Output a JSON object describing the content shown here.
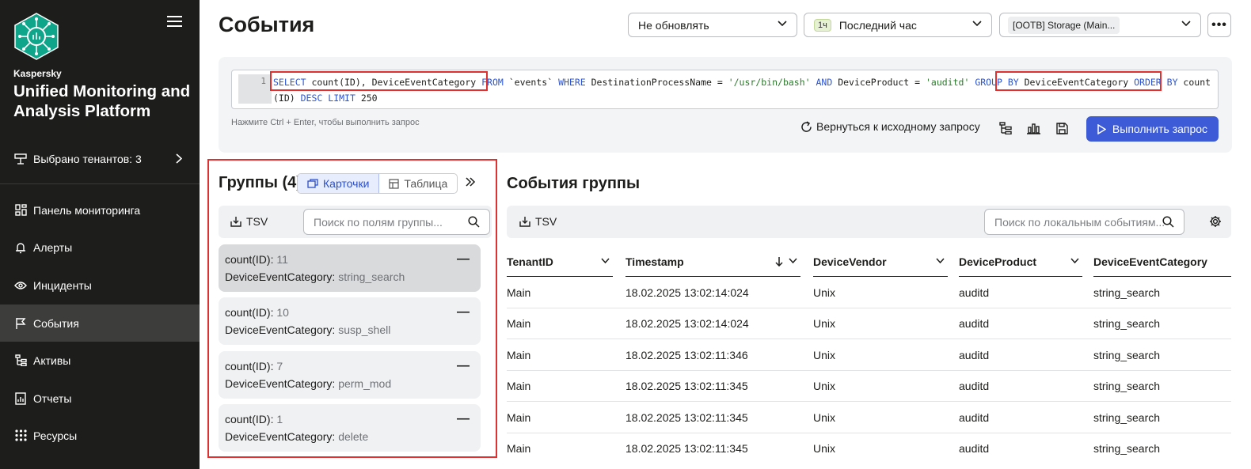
{
  "sidebar": {
    "brand_small": "Kaspersky",
    "brand_big": "Unified Monitoring and Analysis Platform",
    "tenants_label": "Выбрано тенантов: 3",
    "items": [
      {
        "label": "Панель мониторинга",
        "icon": "dashboard-icon"
      },
      {
        "label": "Алерты",
        "icon": "bell-icon"
      },
      {
        "label": "Инциденты",
        "icon": "eye-icon"
      },
      {
        "label": "События",
        "icon": "flag-icon",
        "active": true
      },
      {
        "label": "Активы",
        "icon": "tree-icon"
      },
      {
        "label": "Отчеты",
        "icon": "report-icon"
      },
      {
        "label": "Ресурсы",
        "icon": "grid-icon"
      }
    ]
  },
  "header": {
    "title": "События",
    "refresh_select": "Не обновлять",
    "period_badge": "1ч",
    "period_select": "Последний час",
    "storage_select": "[OOTB] Storage (Main..."
  },
  "query": {
    "line_number": "1",
    "hint": "Нажмите Ctrl + Enter, чтобы выполнить запрос",
    "back_label": "Вернуться к исходному запросу",
    "run_label": "Выполнить запрос"
  },
  "groups": {
    "title": "Группы (4)",
    "view_cards": "Карточки",
    "view_table": "Таблица",
    "tsv_label": "TSV",
    "search_placeholder": "Поиск по полям группы...",
    "cards": [
      {
        "count_key": "count(ID):",
        "count_val": "11",
        "cat_key": "DeviceEventCategory:",
        "cat_val": "string_search"
      },
      {
        "count_key": "count(ID):",
        "count_val": "10",
        "cat_key": "DeviceEventCategory:",
        "cat_val": "susp_shell"
      },
      {
        "count_key": "count(ID):",
        "count_val": "7",
        "cat_key": "DeviceEventCategory:",
        "cat_val": "perm_mod"
      },
      {
        "count_key": "count(ID):",
        "count_val": "1",
        "cat_key": "DeviceEventCategory:",
        "cat_val": "delete"
      }
    ]
  },
  "events_group": {
    "title": "События группы",
    "tsv_label": "TSV",
    "search_placeholder": "Поиск по локальным событиям...",
    "columns": [
      "TenantID",
      "Timestamp",
      "DeviceVendor",
      "DeviceProduct",
      "DeviceEventCategory"
    ],
    "rows": [
      [
        "Main",
        "18.02.2025 13:02:14:024",
        "Unix",
        "auditd",
        "string_search"
      ],
      [
        "Main",
        "18.02.2025 13:02:14:024",
        "Unix",
        "auditd",
        "string_search"
      ],
      [
        "Main",
        "18.02.2025 13:02:11:346",
        "Unix",
        "auditd",
        "string_search"
      ],
      [
        "Main",
        "18.02.2025 13:02:11:345",
        "Unix",
        "auditd",
        "string_search"
      ],
      [
        "Main",
        "18.02.2025 13:02:11:345",
        "Unix",
        "auditd",
        "string_search"
      ],
      [
        "Main",
        "18.02.2025 13:02:11:345",
        "Unix",
        "auditd",
        "string_search"
      ]
    ]
  },
  "colors": {
    "accent": "#3d5bd6",
    "sidebar_bg": "#1d1d1b",
    "highlight": "#e03131"
  }
}
